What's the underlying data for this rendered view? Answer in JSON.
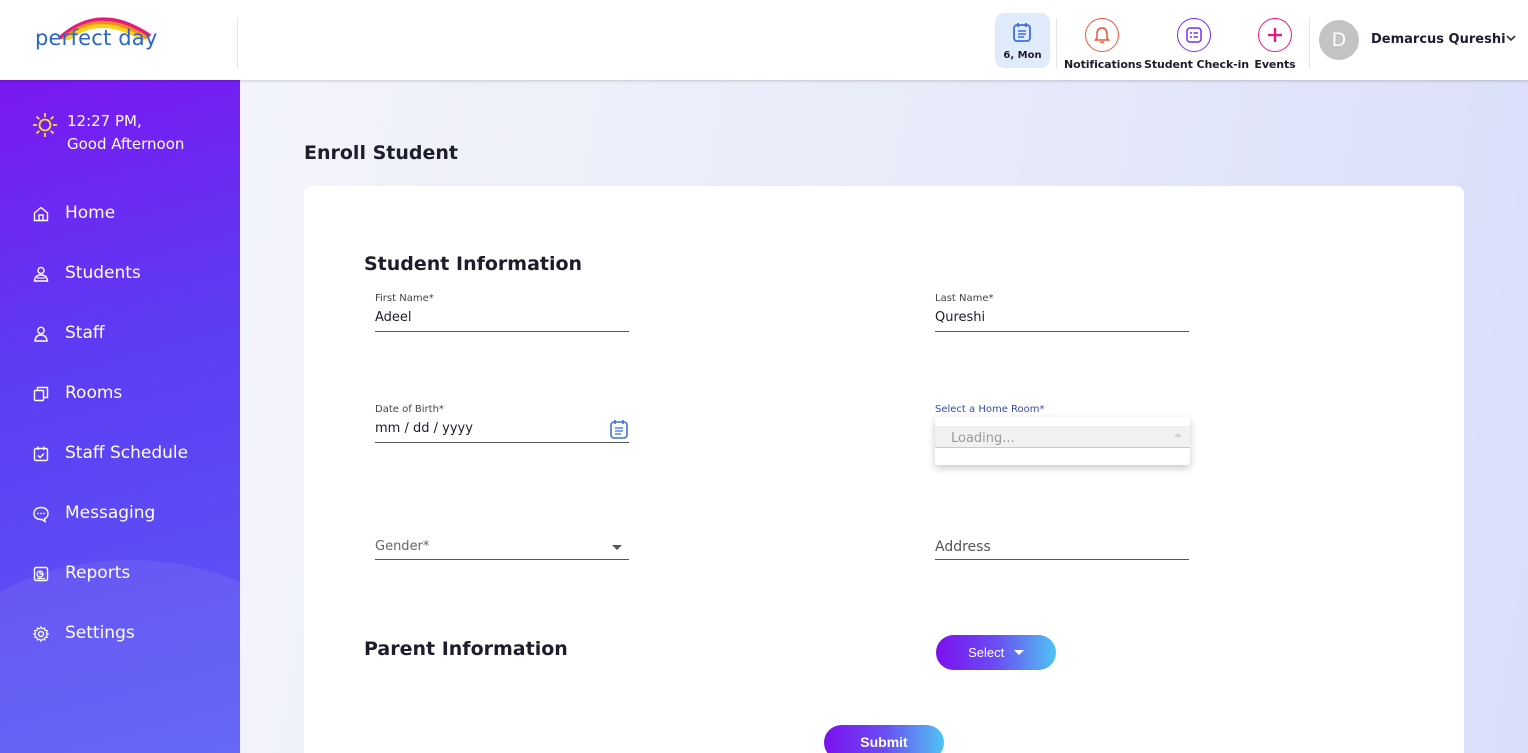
{
  "header": {
    "logo_text": "perfect day",
    "date_chip": "6, Mon",
    "notifications_label": "Notifications",
    "checkin_label": "Student Check-in",
    "events_label": "Events",
    "avatar_letter": "D",
    "user_name": "Demarcus Qureshi",
    "icons": {
      "date": "calendar-icon",
      "notifications": "bell-icon",
      "checkin": "checklist-icon",
      "events": "plus-icon",
      "user_menu": "chevron-down-icon"
    },
    "colors": {
      "bell": "#e8573a",
      "checkin": "#7b2cf2",
      "events": "#e8197e"
    }
  },
  "sidebar": {
    "time": "12:27 PM,",
    "greeting": "Good Afternoon",
    "items": [
      {
        "label": "Home",
        "icon": "home-icon"
      },
      {
        "label": "Students",
        "icon": "students-icon"
      },
      {
        "label": "Staff",
        "icon": "staff-icon"
      },
      {
        "label": "Rooms",
        "icon": "rooms-icon"
      },
      {
        "label": "Staff Schedule",
        "icon": "schedule-icon"
      },
      {
        "label": "Messaging",
        "icon": "message-icon"
      },
      {
        "label": "Reports",
        "icon": "reports-icon"
      },
      {
        "label": "Settings",
        "icon": "gear-icon"
      }
    ]
  },
  "page": {
    "title": "Enroll Student",
    "student_section": "Student Information",
    "first_name": {
      "label": "First Name*",
      "value": "Adeel"
    },
    "last_name": {
      "label": "Last Name*",
      "value": "Qureshi"
    },
    "dob": {
      "label": "Date of Birth*",
      "value": "mm / dd / yyyy"
    },
    "home_room": {
      "label": "Select a Home Room*",
      "loading": "Loading..."
    },
    "gender": {
      "placeholder": "Gender*"
    },
    "address": {
      "placeholder": "Address"
    },
    "parent_section": "Parent Information",
    "select_button": "Select",
    "submit_button": "Submit"
  }
}
